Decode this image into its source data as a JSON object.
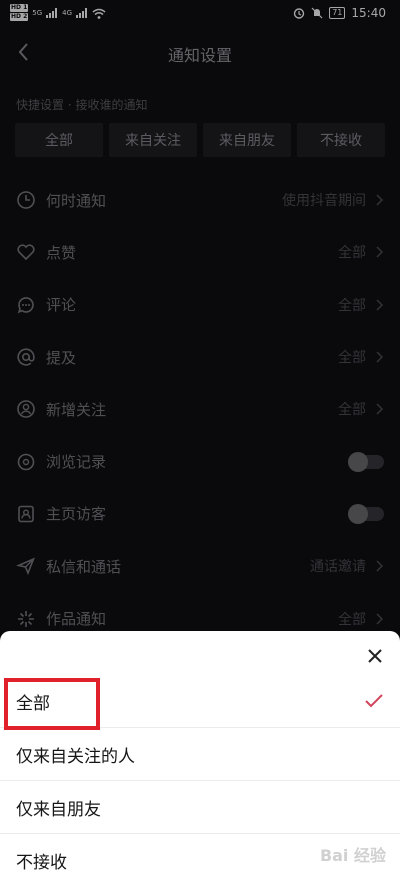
{
  "status": {
    "hd1": "HD 1",
    "hd2": "HD 2",
    "net1": "5G",
    "net2": "4G",
    "battery": "71",
    "time": "15:40"
  },
  "nav": {
    "title": "通知设置"
  },
  "quick": {
    "label": "快捷设置 · 接收谁的通知",
    "buttons": [
      "全部",
      "来自关注",
      "来自朋友",
      "不接收"
    ]
  },
  "rows": [
    {
      "label": "何时通知",
      "value": "使用抖音期间",
      "icon": "clock-icon"
    },
    {
      "label": "点赞",
      "value": "全部",
      "icon": "heart-icon"
    },
    {
      "label": "评论",
      "value": "全部",
      "icon": "comment-icon"
    },
    {
      "label": "提及",
      "value": "全部",
      "icon": "at-icon"
    },
    {
      "label": "新增关注",
      "value": "全部",
      "icon": "user-icon"
    },
    {
      "label": "浏览记录",
      "value": "",
      "icon": "eye-icon",
      "toggle": "off"
    },
    {
      "label": "主页访客",
      "value": "",
      "icon": "profile-icon",
      "toggle": "off"
    },
    {
      "label": "私信和通话",
      "value": "通话邀请",
      "icon": "send-icon"
    },
    {
      "label": "作品通知",
      "value": "全部",
      "icon": "sparkle-icon"
    }
  ],
  "sheet": {
    "options": [
      "全部",
      "仅来自关注的人",
      "仅来自朋友",
      "不接收"
    ],
    "selected": "全部"
  },
  "watermark": "Bai 经验",
  "colors": {
    "accent": "#e0212b",
    "check": "#d0455c",
    "background": "#101014"
  }
}
